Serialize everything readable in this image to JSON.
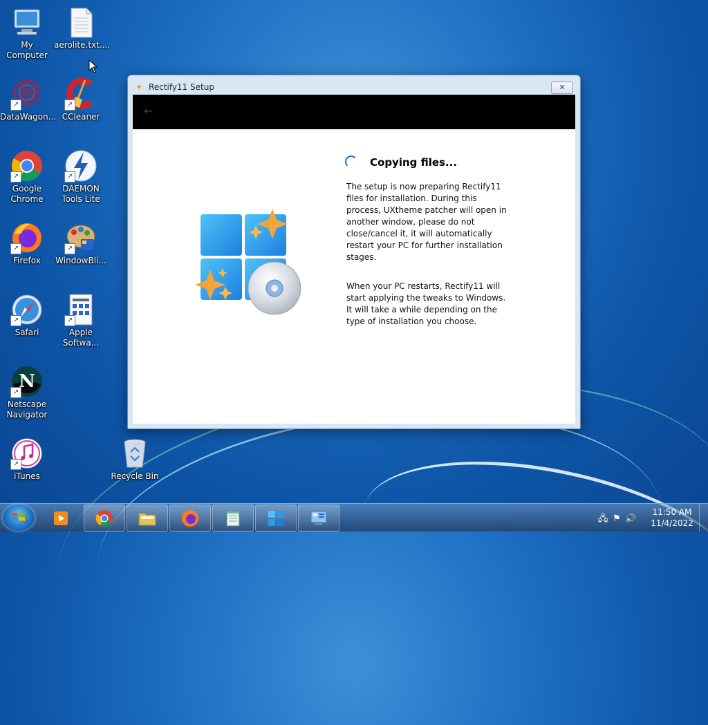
{
  "desktop": {
    "icons": [
      {
        "label": "My Computer",
        "icon": "computer-icon"
      },
      {
        "label": "aerolite.txt....",
        "icon": "text-file-icon"
      },
      {
        "label": "DataWagon...",
        "icon": "datawagon-icon"
      },
      {
        "label": "CCleaner",
        "icon": "ccleaner-icon"
      },
      {
        "label": "Google Chrome",
        "icon": "chrome-icon"
      },
      {
        "label": "DAEMON Tools Lite",
        "icon": "daemon-tools-icon"
      },
      {
        "label": "Firefox",
        "icon": "firefox-icon"
      },
      {
        "label": "WindowBli...",
        "icon": "windowblinds-icon"
      },
      {
        "label": "Safari",
        "icon": "safari-icon"
      },
      {
        "label": "Apple Softwa...",
        "icon": "apple-software-icon"
      },
      {
        "label": "Netscape Navigator",
        "icon": "netscape-icon"
      },
      {
        "label": "iTunes",
        "icon": "itunes-icon"
      },
      {
        "label": "Recycle Bin",
        "icon": "recycle-bin-icon"
      }
    ]
  },
  "dialog": {
    "title": "Rectify11 Setup",
    "close_label": "✕",
    "heading": "Copying files...",
    "paragraph1": "The setup is now preparing Rectify11 files for installation. During this process, UXtheme patcher will open in another window, please do not close/cancel it, it will automatically restart your PC for further installation stages.",
    "paragraph2": "When your PC restarts, Rectify11 will start applying the tweaks to Windows. It will take a while depending on the type of installation you choose.",
    "back_glyph": "←"
  },
  "taskbar": {
    "items": [
      "media-player-icon",
      "chrome-icon",
      "file-explorer-icon",
      "firefox-icon",
      "notepad-icon",
      "rectify11-setup-icon",
      "control-panel-icon"
    ],
    "clock_time": "11:50 AM",
    "clock_date": "11/4/2022"
  },
  "colors": {
    "accent": "#1c6fc0",
    "header": "#000000",
    "wallpaper": "#1f6fc3"
  }
}
